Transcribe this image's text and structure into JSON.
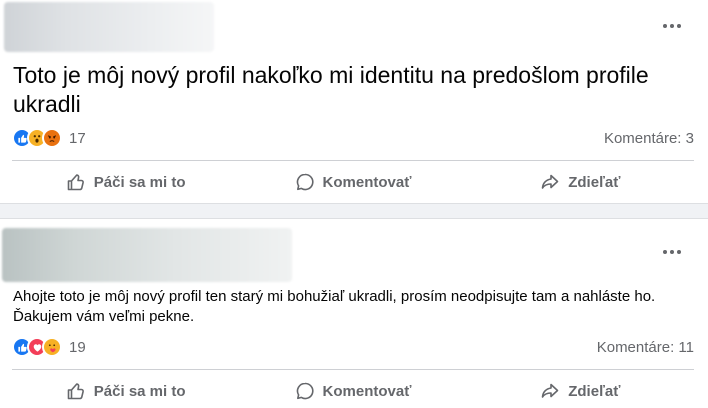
{
  "posts": [
    {
      "text": "Toto je môj nový profil nakoľko mi identitu na predošlom profile ukradli",
      "reactions": [
        "like-icon",
        "wow-icon",
        "angry-icon"
      ],
      "reaction_count": "17",
      "comments": "Komentáre: 3"
    },
    {
      "text": "Ahojte toto je môj nový profil ten starý mi bohužiaľ ukradli, prosím neodpisujte tam a nahláste ho. Ďakujem vám veľmi pekne.",
      "reactions": [
        "like-icon",
        "love-icon",
        "care-icon"
      ],
      "reaction_count": "19",
      "comments": "Komentáre: 11"
    }
  ],
  "actions": {
    "like": "Páči sa mi to",
    "comment": "Komentovať",
    "share": "Zdieľať"
  },
  "colors": {
    "like": "#1877f2",
    "love": "#f33e58",
    "wow": "#f7b125",
    "angry": "#e9710f",
    "muted_text": "#65676b"
  }
}
